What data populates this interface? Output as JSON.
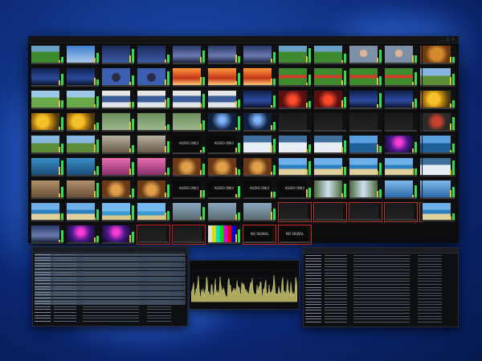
{
  "app": {
    "title": "",
    "window_controls": "_ □ ×"
  },
  "tile_labels": {
    "audio_only": "AUDIO ONLY",
    "no_signal": "NO SIGNAL"
  },
  "colors": {
    "meter_green": "#2ee04c",
    "alarm_red": "#c4281c",
    "background_blue": "#163d96"
  },
  "tiles": [
    [
      "field",
      "sky",
      "news",
      "news",
      "crowd",
      "crowd",
      "crowd",
      "field",
      "field",
      "portrait",
      "portrait",
      "lion",
      "lion"
    ],
    [
      "studio",
      "studio",
      "anchor",
      "anchor",
      "fire",
      "fire",
      "fire",
      "jockey",
      "jockey",
      "jockey",
      "jockey",
      "horse",
      "horse"
    ],
    [
      "golf",
      "golf",
      "desk",
      "desk",
      "desk",
      "desk",
      "studio",
      "redlight",
      "redlight",
      "studio",
      "studio",
      "sunflower",
      "sunflower"
    ],
    [
      "sunflower",
      "sunflower",
      "green",
      "green",
      "green",
      "stage",
      "stage",
      "dark",
      "dark",
      "dark",
      "dark",
      "dark",
      "bull"
    ],
    [
      "horse",
      "horse",
      "rider",
      "rider",
      "audio",
      "audio",
      "snow",
      "snow",
      "snow",
      "sea",
      "concert",
      "sea",
      "sea"
    ],
    [
      "shark",
      "shark",
      "pink",
      "pink",
      "food",
      "food",
      "food",
      "beach",
      "beach",
      "beach",
      "beach",
      "snow",
      "snow"
    ],
    [
      "animal",
      "animal",
      "food",
      "food",
      "audio",
      "audio",
      "audio",
      "audio",
      "waterfall",
      "waterfall",
      "water",
      "water",
      "water"
    ],
    [
      "beach",
      "beach",
      "island",
      "island",
      "rocks",
      "rocks",
      "rocks",
      "dark",
      "dark",
      "dark",
      "dark",
      "dark",
      "beach"
    ],
    [
      "crowd",
      "concert",
      "concert",
      "dark",
      "dark",
      "bars",
      "nosignal",
      "nosignal",
      "blank",
      "blank",
      "blank",
      "blank",
      "blank"
    ]
  ]
}
